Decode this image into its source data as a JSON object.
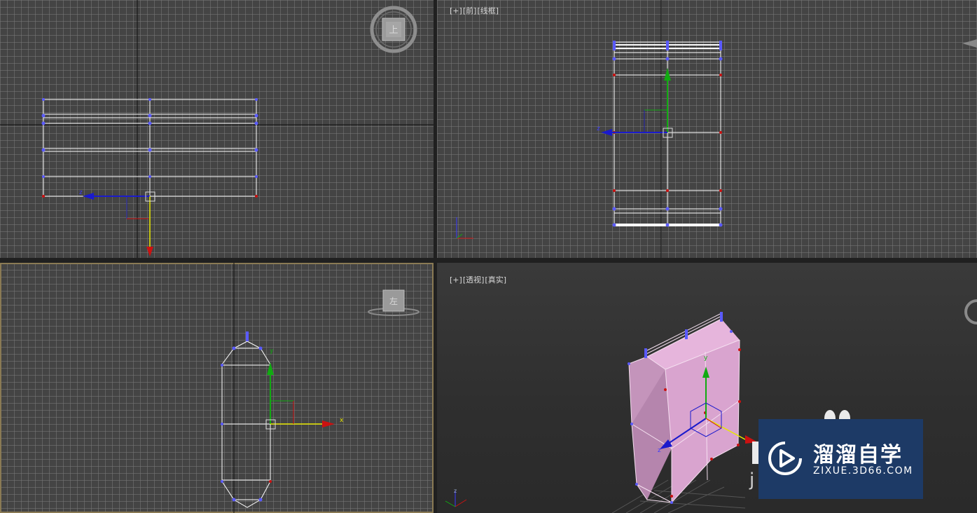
{
  "viewports": {
    "top_left": {
      "label_parts": []
    },
    "top_right": {
      "label_parts": [
        "[+]",
        "[前]",
        "[线框]"
      ]
    },
    "bottom_left": {
      "label_parts": []
    },
    "bottom_right": {
      "label_parts": [
        "[+]",
        "[透视]",
        "[真实]"
      ]
    }
  },
  "viewcube": {
    "top_face": "上",
    "left_face": "左"
  },
  "axes": {
    "x": "x",
    "y": "y",
    "z": "z"
  },
  "watermark": {
    "title": "溜溜自学",
    "subtitle": "ZIXUE.3D66.COM",
    "partial_text": "j"
  },
  "colors": {
    "viewport_bg": "#444444",
    "active_border": "#8a7a54",
    "mesh_fill": "#d9a4cf",
    "vertex_blue": "#5a5aff",
    "vertex_red": "#cc1111",
    "watermark_bg": "#1d3a66"
  }
}
